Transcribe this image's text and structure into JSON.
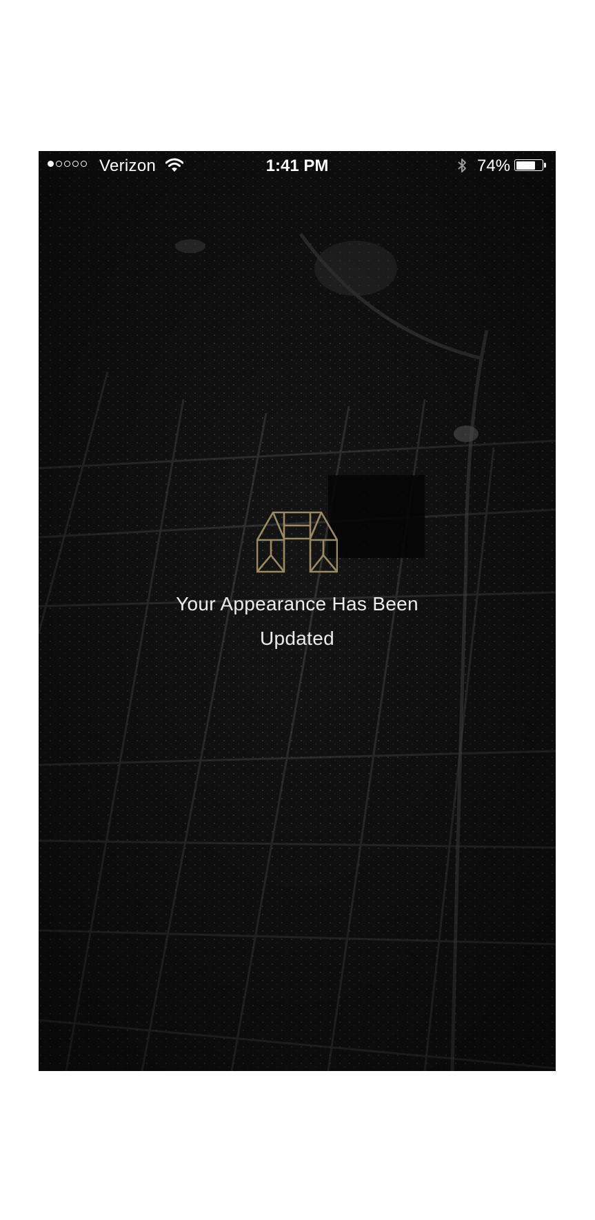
{
  "status_bar": {
    "carrier": "Verizon",
    "time": "1:41 PM",
    "battery_percent": "74%",
    "battery_level": 0.74,
    "signal_bars_filled": 1,
    "signal_bars_total": 5
  },
  "icons": {
    "wifi": "wifi-icon",
    "bluetooth": "bluetooth-icon",
    "battery": "battery-icon",
    "logo": "arch-logo-icon"
  },
  "colors": {
    "logo_gold": "#9c8a63",
    "message_text": "#ececec",
    "background": "#0d0d0d"
  },
  "message": {
    "line1": "Your Appearance Has Been",
    "line2": "Updated"
  }
}
